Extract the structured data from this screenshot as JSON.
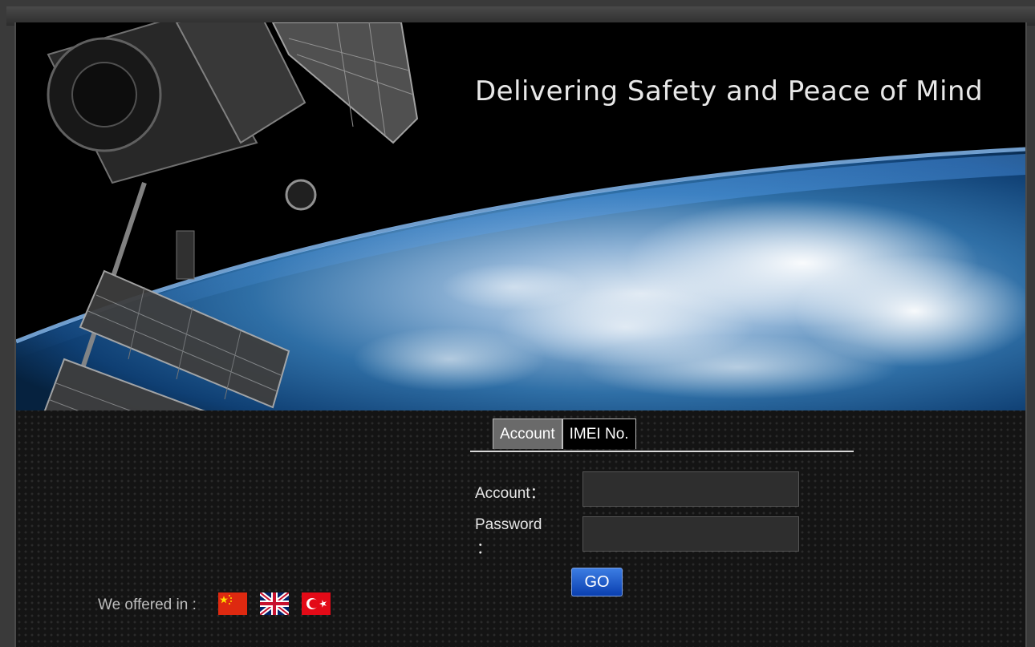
{
  "banner": {
    "tagline": "Delivering Safety and Peace of Mind"
  },
  "login": {
    "tabs": [
      {
        "label": "Account",
        "active": true
      },
      {
        "label": "IMEI No.",
        "active": false
      }
    ],
    "account_label": "Account：",
    "account_value": "",
    "password_label_line1": "Password",
    "password_label_line2": "：",
    "password_value": "",
    "go_label": "GO"
  },
  "footer": {
    "offered_label": "We offered in :",
    "languages": [
      {
        "icon": "china-flag-icon",
        "color": "#de2910"
      },
      {
        "icon": "uk-flag-icon",
        "color": "#012169"
      },
      {
        "icon": "turkey-flag-icon",
        "color": "#e30a17"
      }
    ]
  },
  "colors": {
    "go_button": "#1a55c8",
    "tab_active": "#6a6a6a"
  }
}
